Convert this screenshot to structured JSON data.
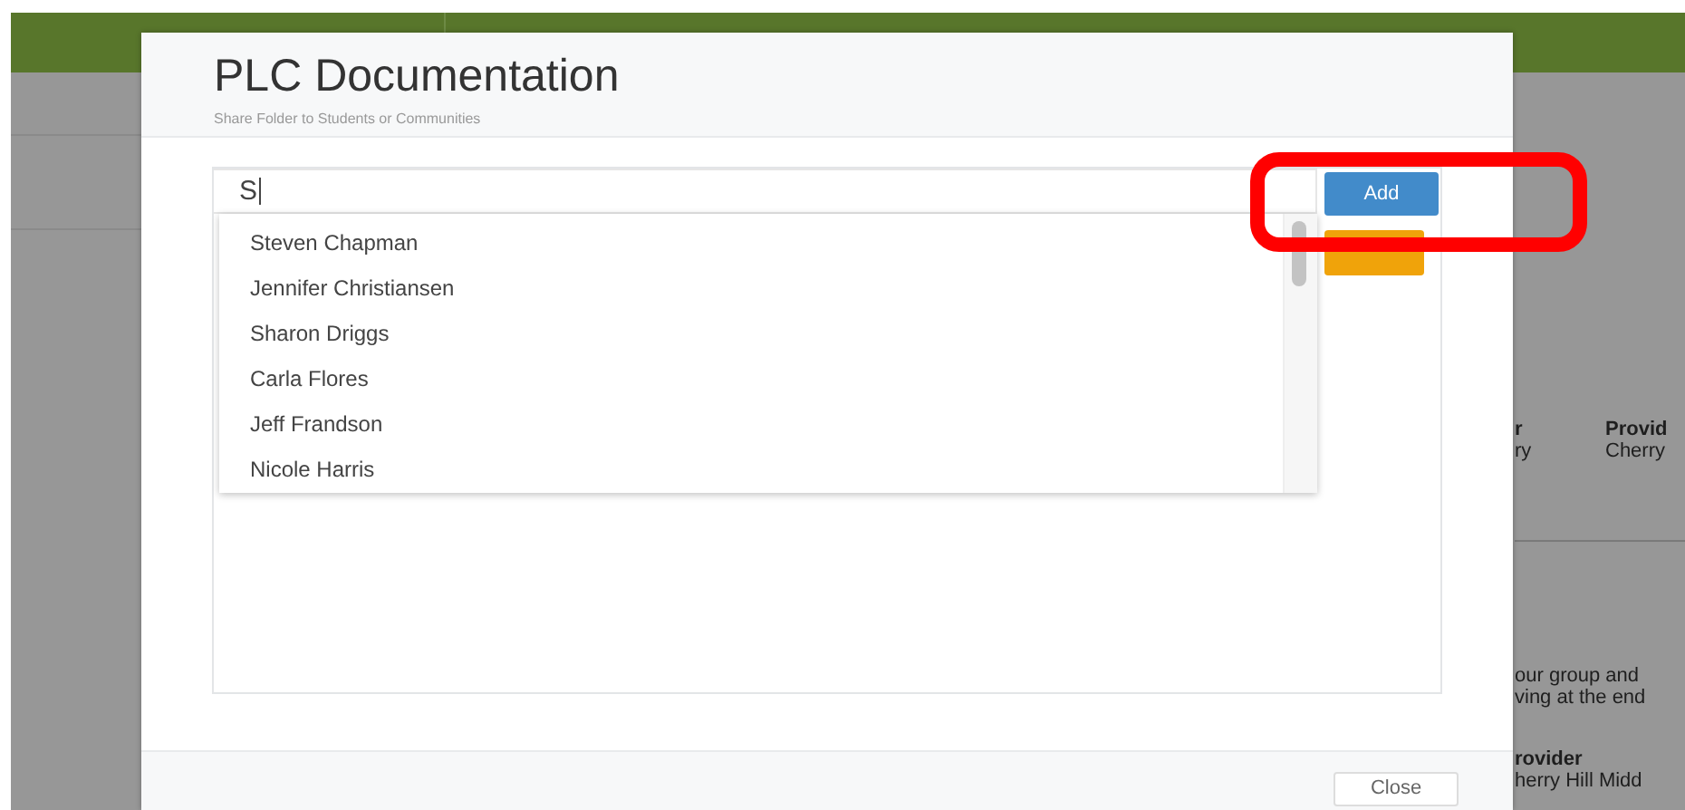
{
  "background_page": {
    "fields": [
      {
        "label": "r",
        "value": "ry"
      },
      {
        "label": "Provid",
        "value": "Cherry"
      }
    ],
    "paragraph": [
      "our group and",
      "ving at the end"
    ],
    "provider": {
      "label": "rovider",
      "value": "herry Hill Midd"
    }
  },
  "modal": {
    "title": "PLC Documentation",
    "subtitle": "Share Folder to Students or Communities",
    "search": {
      "value": "S"
    },
    "suggestions": [
      {
        "name": "Steven Chapman"
      },
      {
        "name": "Jennifer Christiansen"
      },
      {
        "name": "Sharon Driggs"
      },
      {
        "name": "Carla Flores"
      },
      {
        "name": "Jeff Frandson"
      },
      {
        "name": "Nicole Harris"
      }
    ],
    "add_button": "Add",
    "footer_button": "Close"
  },
  "annotation": {
    "kind": "rounded-rectangle"
  }
}
